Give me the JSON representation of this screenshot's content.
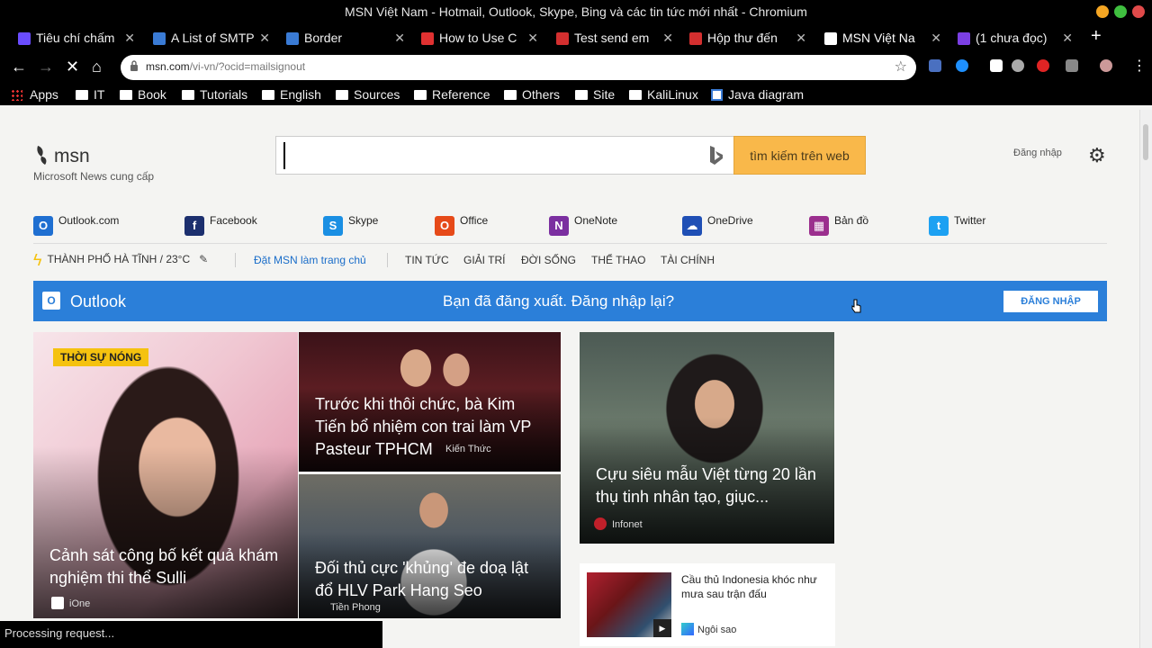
{
  "window": {
    "title": "MSN Việt Nam - Hotmail, Outlook, Skype, Bing và các tin tức mới nhất - Chromium"
  },
  "tabs": [
    {
      "label": "Tiêu chí chấm",
      "favicon_color": "#6a4cff"
    },
    {
      "label": "A List of SMTP",
      "favicon_color": "#3a7bd5"
    },
    {
      "label": "Border",
      "favicon_color": "#3a7bd5"
    },
    {
      "label": "How to Use C",
      "favicon_color": "#e03131"
    },
    {
      "label": "Test send em",
      "favicon_color": "#d32f2f"
    },
    {
      "label": "Hộp thư đến",
      "favicon_color": "#d32f2f"
    },
    {
      "label": "MSN Việt Na",
      "favicon_color": "#ffffff",
      "active": true
    },
    {
      "label": "(1 chưa đọc)",
      "favicon_color": "#7b3fe4"
    }
  ],
  "toolbar": {
    "url_host": "msn.com",
    "url_path": "/vi-vn/?ocid=mailsignout"
  },
  "bookmarks": [
    {
      "label": "Apps",
      "type": "apps"
    },
    {
      "label": "IT",
      "type": "folder"
    },
    {
      "label": "Book",
      "type": "folder"
    },
    {
      "label": "Tutorials",
      "type": "folder"
    },
    {
      "label": "English",
      "type": "folder"
    },
    {
      "label": "Sources",
      "type": "folder"
    },
    {
      "label": "Reference",
      "type": "folder"
    },
    {
      "label": "Others",
      "type": "folder"
    },
    {
      "label": "Site",
      "type": "folder"
    },
    {
      "label": "KaliLinux",
      "type": "folder"
    },
    {
      "label": "Java diagram",
      "type": "page"
    }
  ],
  "header": {
    "logo": "msn",
    "logo_sub": "Microsoft News cung cấp",
    "search_button": "tìm kiếm trên web",
    "signin": "Đăng nhập"
  },
  "services": [
    {
      "label": "Outlook.com",
      "icon": "outlook-icon",
      "color": "#1f6fd1",
      "glyph": "O"
    },
    {
      "label": "Facebook",
      "icon": "facebook-icon",
      "color": "#1c2f6e",
      "glyph": "f"
    },
    {
      "label": "Skype",
      "icon": "skype-icon",
      "color": "#1a8fe3",
      "glyph": "S"
    },
    {
      "label": "Office",
      "icon": "office-icon",
      "color": "#e64a19",
      "glyph": "O"
    },
    {
      "label": "OneNote",
      "icon": "onenote-icon",
      "color": "#7b2fa0",
      "glyph": "N"
    },
    {
      "label": "OneDrive",
      "icon": "onedrive-icon",
      "color": "#1f4fb5",
      "glyph": "☁"
    },
    {
      "label": "Bản đồ",
      "icon": "map-icon",
      "color": "#9b2f8e",
      "glyph": "▦"
    },
    {
      "label": "Twitter",
      "icon": "twitter-icon",
      "color": "#1da1f2",
      "glyph": "t"
    }
  ],
  "nav": {
    "weather": "THÀNH PHỐ HÀ TĨNH / 23°C",
    "homepage": "Đặt MSN làm trang chủ",
    "links": [
      "TIN TỨC",
      "GIẢI TRÍ",
      "ĐỜI SỐNG",
      "THỂ THAO",
      "TÀI CHÍNH"
    ]
  },
  "banner": {
    "brand": "Outlook",
    "message": "Bạn đã đăng xuất. Đăng nhập lại?",
    "button": "ĐĂNG NHẬP"
  },
  "cards": {
    "main": {
      "badge": "THỜI SỰ NÓNG",
      "headline": "Cảnh sát công bố kết quả khám nghiệm thi thể Sulli",
      "source": "iOne"
    },
    "top_mid": {
      "headline": "Trước khi thôi chức, bà Kim Tiến bổ nhiệm con trai làm VP Pasteur TPHCM",
      "source": "Kiến Thức"
    },
    "bottom_mid": {
      "headline": "Đối thủ cực 'khủng' đe doạ lật đổ HLV Park Hang Seo",
      "source": "Tiền Phong"
    },
    "right": {
      "headline": "Cựu siêu mẫu Việt từng 20 lần thụ tinh nhân tạo, giục...",
      "source": "Infonet"
    },
    "small": {
      "headline": "Cầu thủ Indonesia khóc như mưa sau trận đấu",
      "source": "Ngôi sao"
    }
  },
  "status": "Processing request..."
}
